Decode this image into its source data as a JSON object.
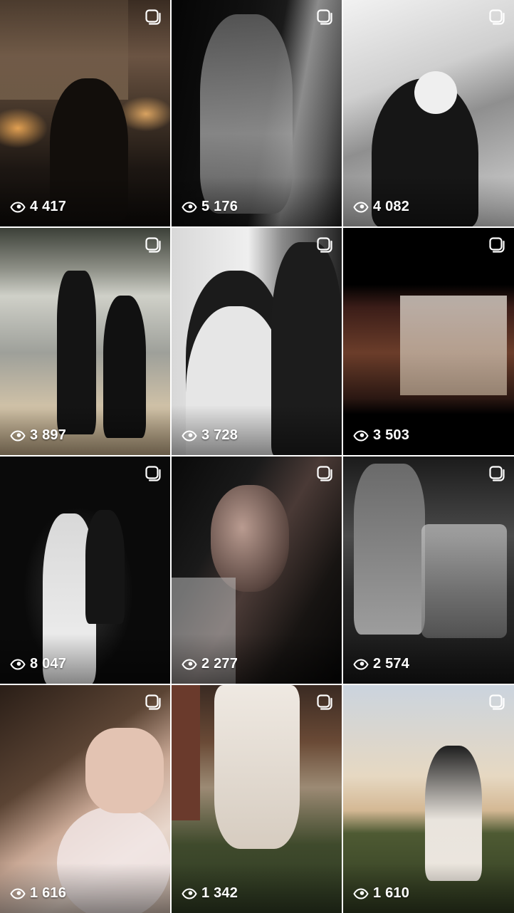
{
  "grid": {
    "items": [
      {
        "views": "4 417",
        "media_type": "reel"
      },
      {
        "views": "5 176",
        "media_type": "reel"
      },
      {
        "views": "4 082",
        "media_type": "reel"
      },
      {
        "views": "3 897",
        "media_type": "reel"
      },
      {
        "views": "3 728",
        "media_type": "reel"
      },
      {
        "views": "3 503",
        "media_type": "reel"
      },
      {
        "views": "8 047",
        "media_type": "reel"
      },
      {
        "views": "2 277",
        "media_type": "reel"
      },
      {
        "views": "2 574",
        "media_type": "reel"
      },
      {
        "views": "1 616",
        "media_type": "reel"
      },
      {
        "views": "1 342",
        "media_type": "reel"
      },
      {
        "views": "1 610",
        "media_type": "reel"
      }
    ]
  },
  "icons": {
    "reel": "reels-icon",
    "views": "eye-icon"
  },
  "colors": {
    "overlay_text": "#ffffff",
    "background": "#ffffff"
  }
}
